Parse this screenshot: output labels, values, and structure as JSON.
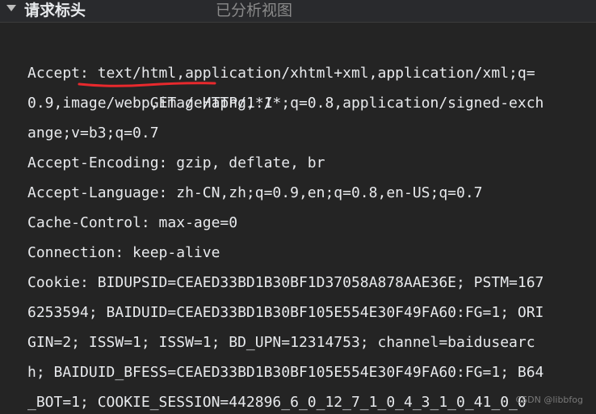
{
  "header": {
    "title": "请求标头",
    "view_parsed": "已分析视图"
  },
  "request_line": "GET / HTTP/1.1",
  "raw_lines": [
    "Accept: text/html,application/xhtml+xml,application/xml;q=",
    "0.9,image/webp,image/apng,*/*;q=0.8,application/signed-exch",
    "ange;v=b3;q=0.7",
    "Accept-Encoding: gzip, deflate, br",
    "Accept-Language: zh-CN,zh;q=0.9,en;q=0.8,en-US;q=0.7",
    "Cache-Control: max-age=0",
    "Connection: keep-alive",
    "Cookie: BIDUPSID=CEAED33BD1B30BF1D37058A878AAE36E; PSTM=167",
    "6253594; BAIDUID=CEAED33BD1B30BF105E554E30F49FA60:FG=1; ORI",
    "GIN=2; ISSW=1; ISSW=1; BD_UPN=12314753; channel=baidusearc",
    "h; BAIDUID_BFESS=CEAED33BD1B30BF105E554E30F49FA60:FG=1; B64",
    "_BOT=1; COOKIE_SESSION=442896_6_0_12_7_1_0_4_3_1_0_41_0_0"
  ],
  "watermark": "CSDN @libbfog",
  "colors": {
    "background": "#242424",
    "text": "#e8eaed",
    "underline": "#e8292d",
    "muted": "#8a8a8a"
  },
  "icons": {
    "toggle": "triangle-down-icon"
  }
}
